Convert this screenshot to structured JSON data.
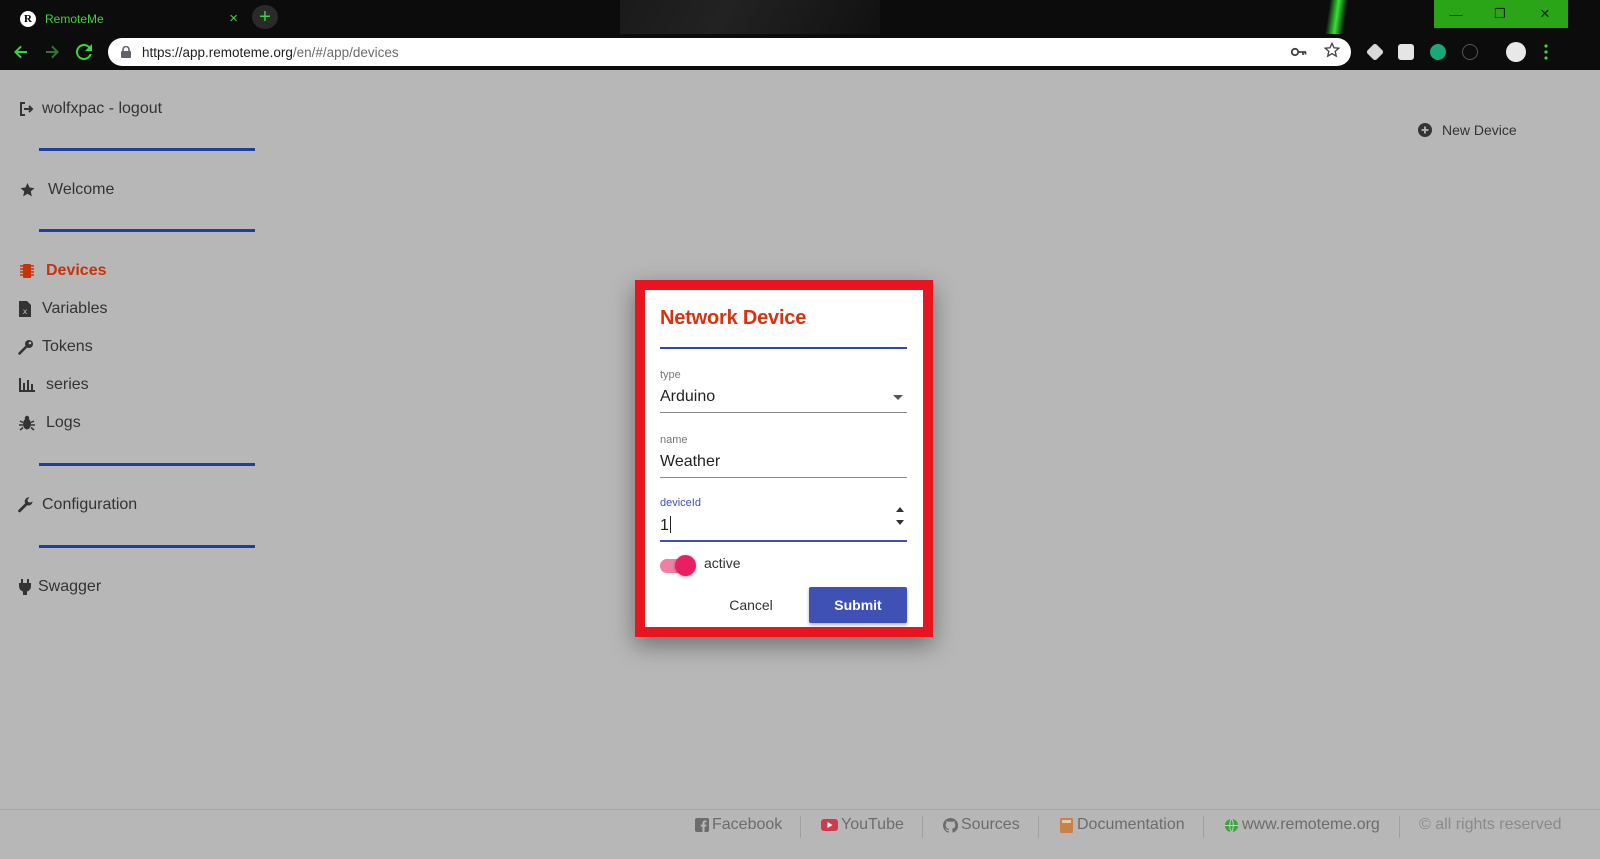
{
  "browser": {
    "tab_title": "RemoteMe",
    "tab_logo": "R",
    "tab_close": "×",
    "new_tab": "+",
    "url_host": "https://app.remoteme.org",
    "url_path": "/en/#/app/devices",
    "controls": {
      "minimize": "—",
      "maximize": "❐",
      "close": "✕"
    },
    "accent_color": "#3cd43c"
  },
  "sidebar": {
    "user": {
      "label": "wolfxpac - logout",
      "icon": "sign-out-icon"
    },
    "welcome": {
      "label": "Welcome",
      "icon": "star-icon"
    },
    "items": [
      {
        "label": "Devices",
        "icon": "chip-icon",
        "active": true
      },
      {
        "label": "Variables",
        "icon": "variable-file-icon"
      },
      {
        "label": "Tokens",
        "icon": "key-icon"
      },
      {
        "label": "series",
        "icon": "bar-chart-icon"
      },
      {
        "label": "Logs",
        "icon": "bug-icon"
      }
    ],
    "configuration": {
      "label": "Configuration",
      "icon": "wrench-icon"
    },
    "swagger": {
      "label": "Swagger",
      "icon": "plug-icon"
    },
    "active_color": "#c6330a",
    "divider_color": "#1d3fa3"
  },
  "header": {
    "new_device": "New Device",
    "new_device_icon": "plus-circle-icon"
  },
  "dialog": {
    "title": "Network Device",
    "type_label": "type",
    "type_value": "Arduino",
    "name_label": "name",
    "name_value": "Weather",
    "deviceid_label": "deviceId",
    "deviceid_value": "1",
    "active_label": "active",
    "active_on": true,
    "cancel_label": "Cancel",
    "submit_label": "Submit",
    "highlight_color": "#e8141f",
    "primary_color": "#3f51b5",
    "toggle_color": "#e91e63"
  },
  "footer": {
    "links": [
      {
        "label": "Facebook",
        "icon": "facebook-icon"
      },
      {
        "label": "YouTube",
        "icon": "youtube-icon"
      },
      {
        "label": "Sources",
        "icon": "github-icon"
      },
      {
        "label": "Documentation",
        "icon": "book-icon"
      },
      {
        "label": "www.remoteme.org",
        "icon": "globe-icon"
      }
    ],
    "copyright": "© all rights reserved"
  }
}
